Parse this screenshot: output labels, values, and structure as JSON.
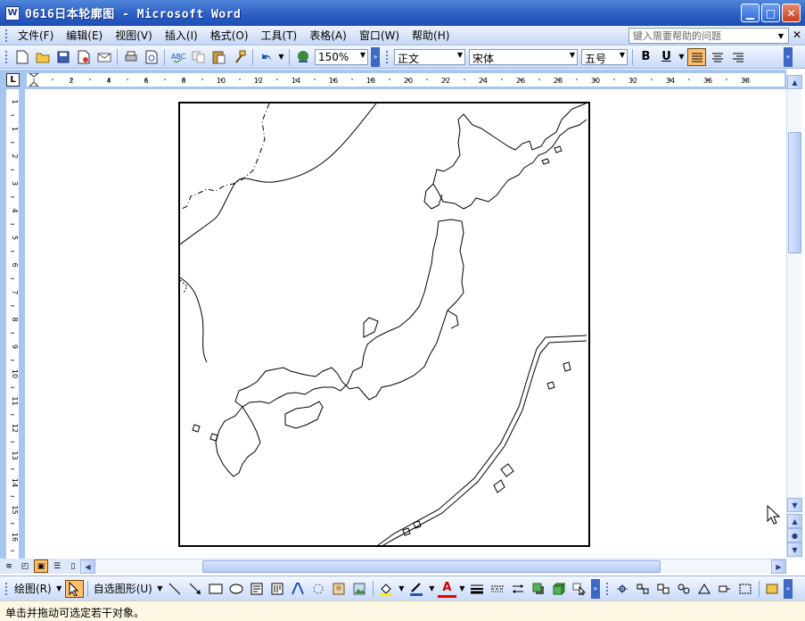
{
  "window": {
    "title": "0616日本轮廓图 - Microsoft Word",
    "app_icon": "W"
  },
  "menu": {
    "items": [
      "文件(F)",
      "编辑(E)",
      "视图(V)",
      "插入(I)",
      "格式(O)",
      "工具(T)",
      "表格(A)",
      "窗口(W)",
      "帮助(H)"
    ],
    "help_placeholder": "键入需要帮助的问题"
  },
  "toolbar": {
    "zoom": "150%",
    "style": "正文",
    "font": "宋体",
    "size": "五号",
    "bold": "B",
    "underline": "U"
  },
  "ruler": {
    "h_labels": [
      "2",
      "4",
      "6",
      "8",
      "10",
      "12",
      "14",
      "16",
      "18",
      "20",
      "22",
      "24",
      "26",
      "28",
      "30",
      "32",
      "34",
      "36",
      "38"
    ],
    "v_labels": [
      "1",
      "1",
      "2",
      "3",
      "4",
      "5",
      "6",
      "7",
      "8",
      "9",
      "10",
      "11",
      "12",
      "13",
      "14",
      "15",
      "16",
      "17"
    ]
  },
  "drawbar": {
    "draw_label": "绘图(R)",
    "autoshape_label": "自选图形(U)",
    "text_a": "A"
  },
  "status": {
    "text": "单击并拖动可选定若干对象。"
  },
  "colors": {
    "title_bar": "#2a5cc4",
    "toolbar": "#c9dafa",
    "ruler_bg": "#a7c6ef",
    "status_bg": "#fcf8e3",
    "active_button": "#ffbf6d"
  }
}
